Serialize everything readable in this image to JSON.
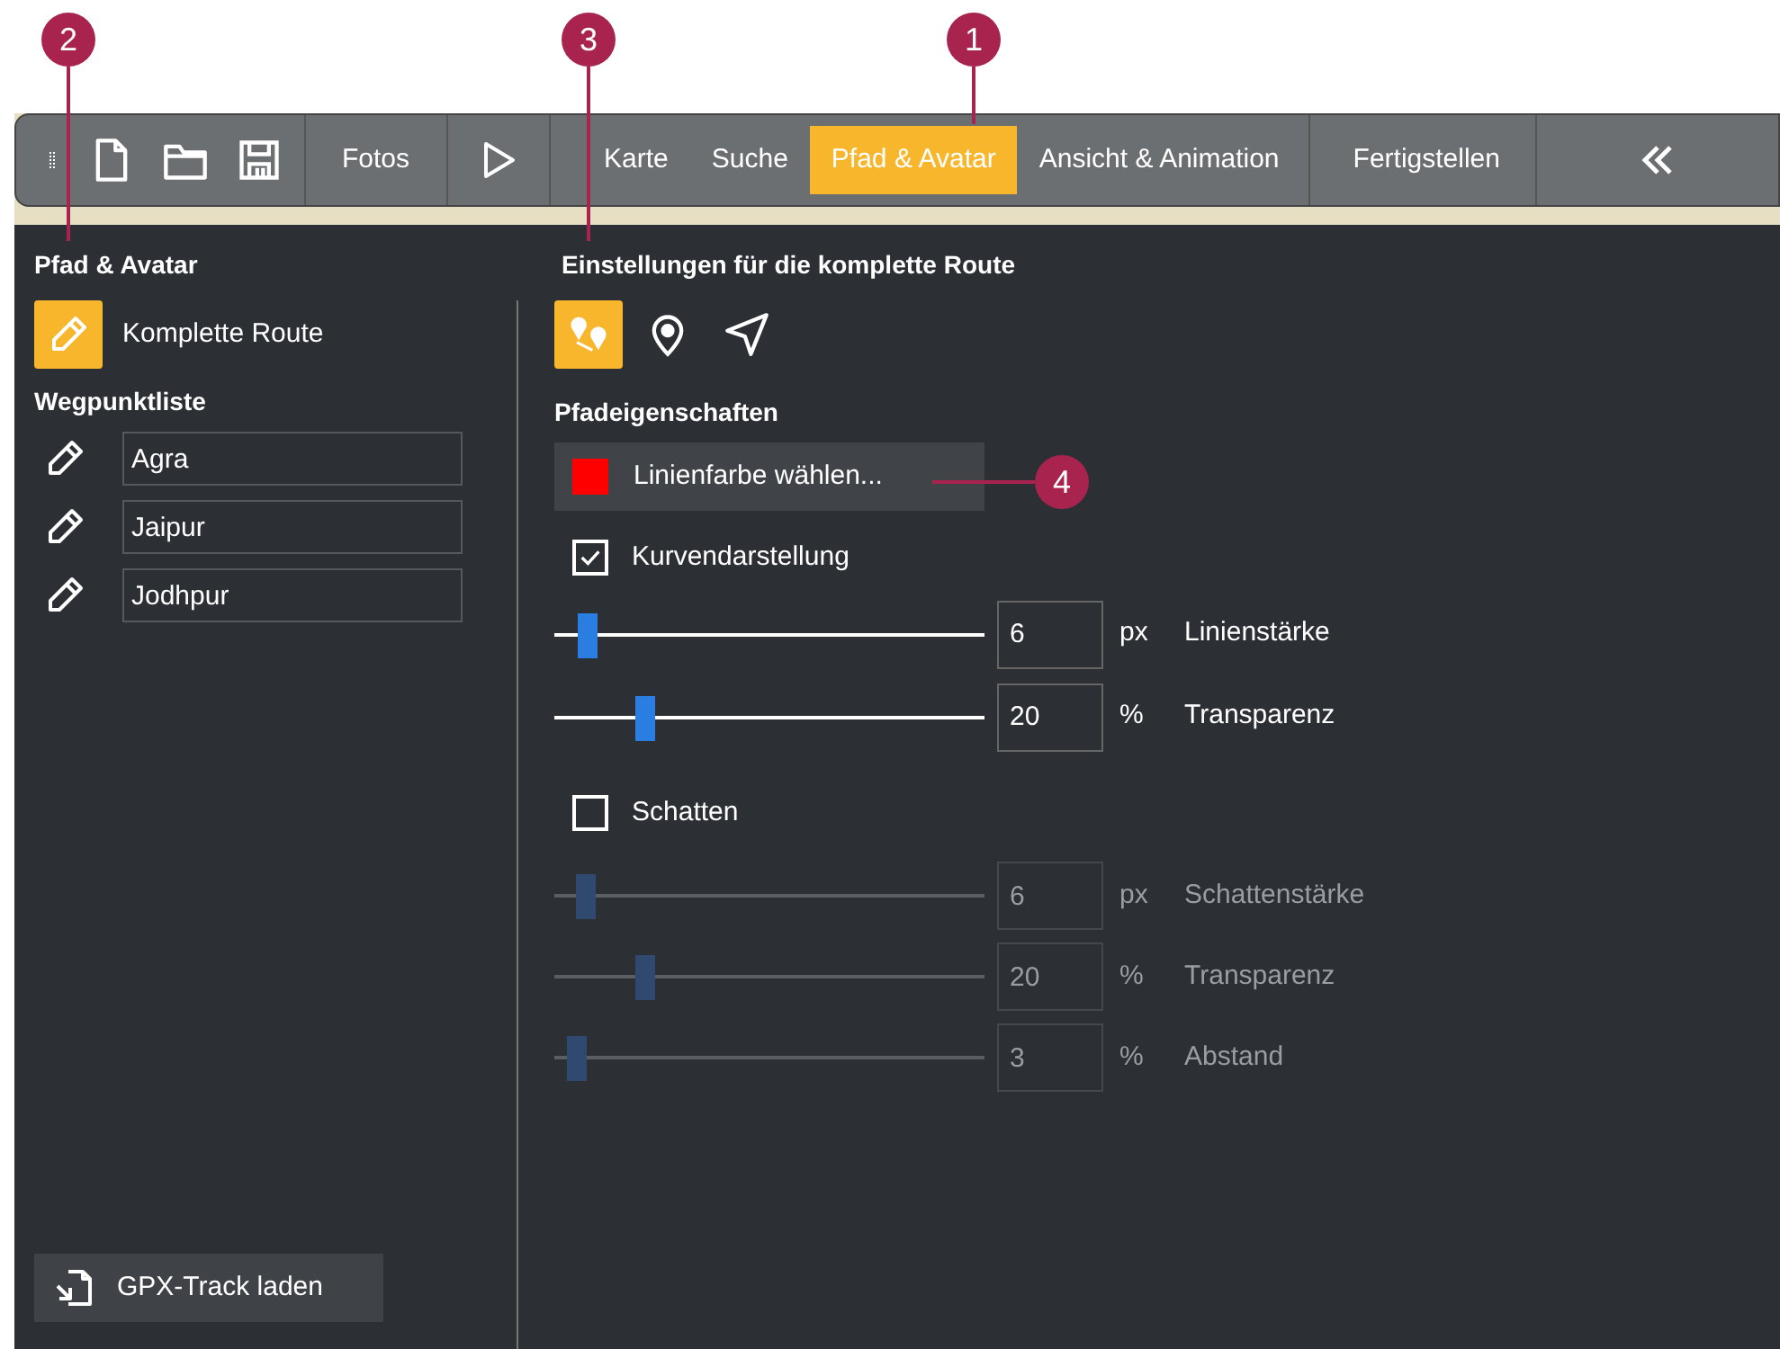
{
  "toolbar": {
    "fotos_button": "Fotos",
    "tabs": [
      {
        "label": "Karte",
        "selected": false
      },
      {
        "label": "Suche",
        "selected": false
      },
      {
        "label": "Pfad & Avatar",
        "selected": true
      },
      {
        "label": "Ansicht & Animation",
        "selected": false
      },
      {
        "label": "Fertigstellen",
        "selected": false
      }
    ]
  },
  "left_panel": {
    "title": "Pfad & Avatar",
    "route_item": {
      "label": "Komplette Route",
      "selected": true
    },
    "waypoint_heading": "Wegpunktliste",
    "waypoints": [
      {
        "value": "Agra"
      },
      {
        "value": "Jaipur"
      },
      {
        "value": "Jodhpur"
      }
    ],
    "gpx_button": "GPX-Track laden"
  },
  "right_panel": {
    "title": "Einstellungen für die komplette Route",
    "modes": [
      {
        "kind": "path",
        "selected": true
      },
      {
        "kind": "pin",
        "selected": false
      },
      {
        "kind": "arrow",
        "selected": false
      }
    ],
    "section_heading": "Pfadeigenschaften",
    "color_button": {
      "label": "Linienfarbe wählen...",
      "color": "#ff0000"
    },
    "curve_checkbox": {
      "label": "Kurvendarstellung",
      "checked": true
    },
    "path_sliders": [
      {
        "value": "6",
        "unit": "px",
        "label": "Linienstärke",
        "level": 0.075,
        "disabled": false
      },
      {
        "value": "20",
        "unit": "%",
        "label": "Transparenz",
        "level": 0.21,
        "disabled": false
      }
    ],
    "shadow_checkbox": {
      "label": "Schatten",
      "checked": false
    },
    "shadow_sliders": [
      {
        "value": "6",
        "unit": "px",
        "label": "Schattenstärke",
        "level": 0.07,
        "disabled": true
      },
      {
        "value": "20",
        "unit": "%",
        "label": "Transparenz",
        "level": 0.21,
        "disabled": true
      },
      {
        "value": "3",
        "unit": "%",
        "label": "Abstand",
        "level": 0.05,
        "disabled": true
      }
    ]
  },
  "callouts": [
    {
      "number": "2"
    },
    {
      "number": "3"
    },
    {
      "number": "1"
    },
    {
      "number": "4"
    }
  ]
}
